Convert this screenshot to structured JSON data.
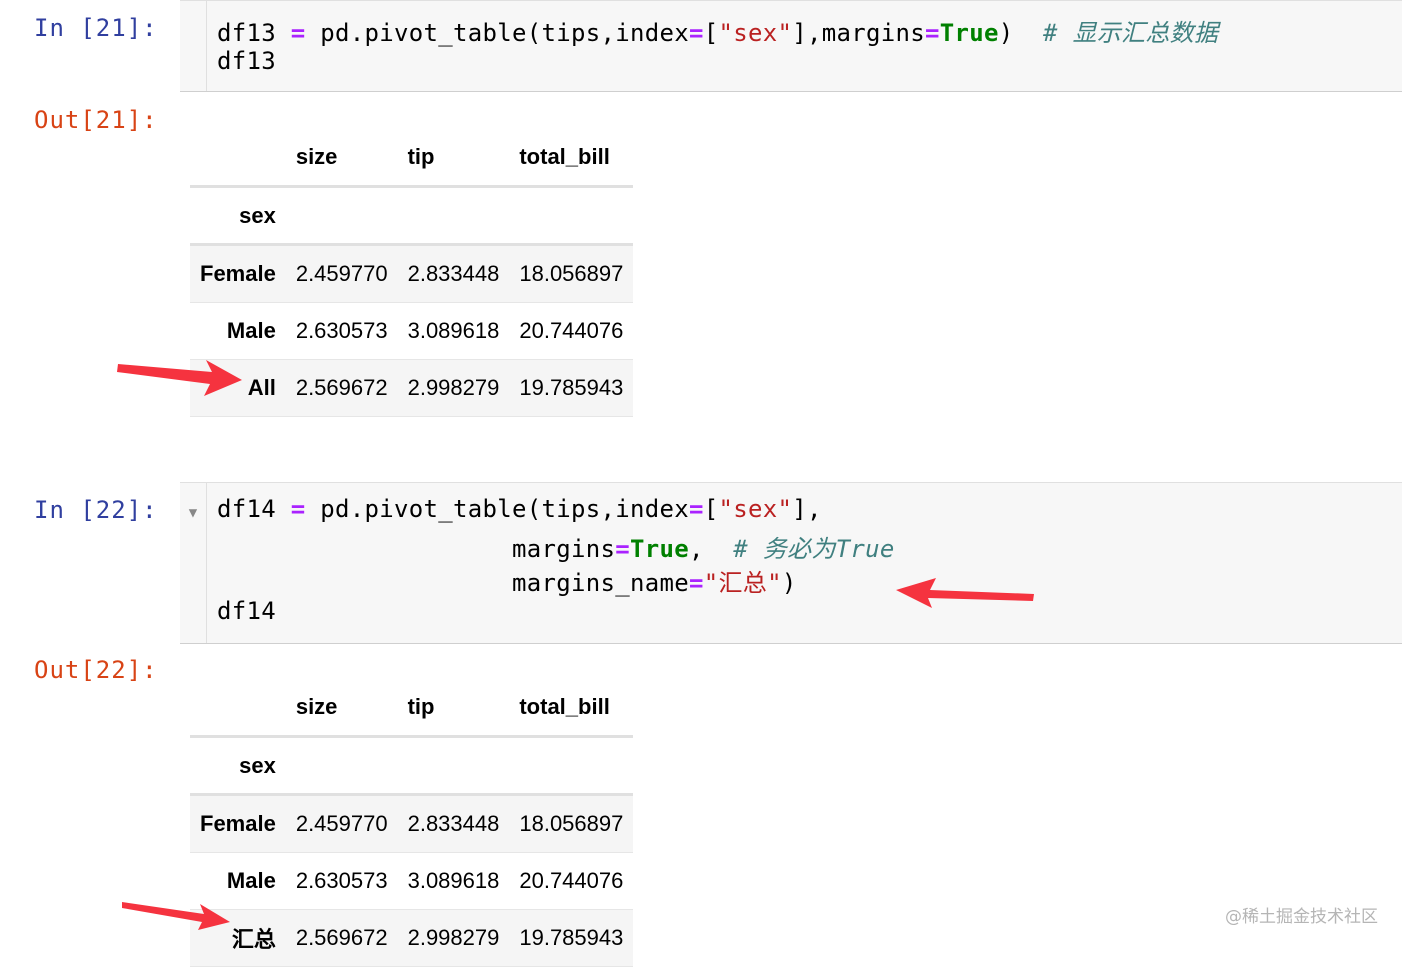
{
  "cells": [
    {
      "in_prompt": "In [21]:",
      "code_lines": [
        [
          {
            "t": "df13 "
          },
          {
            "t": "=",
            "c": "op"
          },
          {
            "t": " pd.pivot_table(tips,index"
          },
          {
            "t": "=",
            "c": "op"
          },
          {
            "t": "["
          },
          {
            "t": "\"sex\"",
            "c": "str"
          },
          {
            "t": "],margins"
          },
          {
            "t": "=",
            "c": "op"
          },
          {
            "t": "True",
            "c": "kw"
          },
          {
            "t": ")  "
          },
          {
            "t": "# 显示汇总数据",
            "c": "cmt"
          }
        ],
        [
          {
            "t": "df13"
          }
        ]
      ],
      "out_prompt": "Out[21]:",
      "table": {
        "columns": [
          "size",
          "tip",
          "total_bill"
        ],
        "index_name": "sex",
        "rows": [
          {
            "label": "Female",
            "values": [
              "2.459770",
              "2.833448",
              "18.056897"
            ]
          },
          {
            "label": "Male",
            "values": [
              "2.630573",
              "3.089618",
              "20.744076"
            ]
          },
          {
            "label": "All",
            "values": [
              "2.569672",
              "2.998279",
              "19.785943"
            ]
          }
        ]
      }
    },
    {
      "in_prompt": "In [22]:",
      "collapse_icon": "▼",
      "code_lines": [
        [
          {
            "t": "df14 "
          },
          {
            "t": "=",
            "c": "op"
          },
          {
            "t": " pd.pivot_table(tips,index"
          },
          {
            "t": "=",
            "c": "op"
          },
          {
            "t": "["
          },
          {
            "t": "\"sex\"",
            "c": "str"
          },
          {
            "t": "],"
          }
        ],
        [
          {
            "t": "                    margins"
          },
          {
            "t": "=",
            "c": "op"
          },
          {
            "t": "True",
            "c": "kw"
          },
          {
            "t": ",  "
          },
          {
            "t": "# 务必为True",
            "c": "cmt"
          }
        ],
        [
          {
            "t": "                    margins_name"
          },
          {
            "t": "=",
            "c": "op"
          },
          {
            "t": "\"汇总\"",
            "c": "str"
          },
          {
            "t": ")"
          }
        ],
        [
          {
            "t": "df14"
          }
        ]
      ],
      "out_prompt": "Out[22]:",
      "table": {
        "columns": [
          "size",
          "tip",
          "total_bill"
        ],
        "index_name": "sex",
        "rows": [
          {
            "label": "Female",
            "values": [
              "2.459770",
              "2.833448",
              "18.056897"
            ]
          },
          {
            "label": "Male",
            "values": [
              "2.630573",
              "3.089618",
              "20.744076"
            ]
          },
          {
            "label": "汇总",
            "values": [
              "2.569672",
              "2.998279",
              "19.785943"
            ]
          }
        ]
      }
    }
  ],
  "watermark": "@稀土掘金技术社区",
  "colors": {
    "arrow": "#f5333f",
    "in_prompt": "#303f9f",
    "out_prompt": "#d84315"
  }
}
